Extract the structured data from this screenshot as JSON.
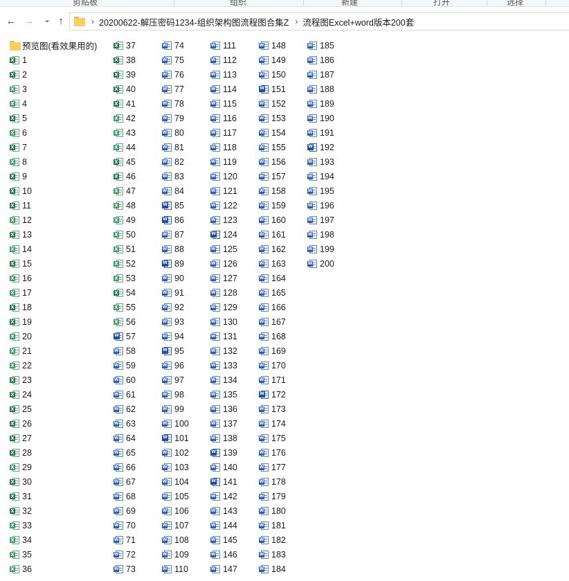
{
  "ribbon": {
    "groups": [
      "剪贴板",
      "组织",
      "新建",
      "打开",
      "选择"
    ]
  },
  "nav": {
    "back_icon": "←",
    "forward_icon": "→",
    "recent_icon": "⌄",
    "up_icon": "↑"
  },
  "breadcrumb": {
    "separator": "›",
    "items": [
      "20200622-解压密码1234-组织架构图流程图合集Z",
      "流程图Excel+word版本200套"
    ]
  },
  "files": {
    "folder": {
      "name": "预览图(看效果用的)",
      "icon": "folder-icon"
    },
    "columns": [
      [
        {
          "name": "1",
          "type": "xls"
        },
        {
          "name": "2",
          "type": "xls"
        },
        {
          "name": "3",
          "type": "xls-alt"
        },
        {
          "name": "4",
          "type": "xls-alt"
        },
        {
          "name": "5",
          "type": "xls"
        },
        {
          "name": "6",
          "type": "xls-alt"
        },
        {
          "name": "7",
          "type": "xls"
        },
        {
          "name": "8",
          "type": "xls-alt"
        },
        {
          "name": "9",
          "type": "xls"
        },
        {
          "name": "10",
          "type": "xls"
        },
        {
          "name": "11",
          "type": "xls"
        },
        {
          "name": "12",
          "type": "xls-alt"
        },
        {
          "name": "13",
          "type": "xls"
        },
        {
          "name": "14",
          "type": "xls-alt"
        },
        {
          "name": "15",
          "type": "xls"
        },
        {
          "name": "16",
          "type": "xls-alt"
        },
        {
          "name": "17",
          "type": "xls-alt"
        },
        {
          "name": "18",
          "type": "xls"
        },
        {
          "name": "19",
          "type": "xls"
        },
        {
          "name": "20",
          "type": "xls-alt"
        },
        {
          "name": "21",
          "type": "xls-alt"
        },
        {
          "name": "22",
          "type": "xls-alt"
        },
        {
          "name": "23",
          "type": "xls"
        },
        {
          "name": "24",
          "type": "xls"
        },
        {
          "name": "25",
          "type": "xls"
        },
        {
          "name": "26",
          "type": "xls"
        },
        {
          "name": "27",
          "type": "xls"
        },
        {
          "name": "28",
          "type": "xls"
        },
        {
          "name": "29",
          "type": "xls-alt"
        },
        {
          "name": "30",
          "type": "xls"
        },
        {
          "name": "31",
          "type": "xls"
        },
        {
          "name": "32",
          "type": "xls"
        },
        {
          "name": "33",
          "type": "xls-alt"
        },
        {
          "name": "34",
          "type": "xls-alt"
        },
        {
          "name": "35",
          "type": "xls-alt"
        },
        {
          "name": "36",
          "type": "xls-alt"
        }
      ],
      [
        {
          "name": "37",
          "type": "xls"
        },
        {
          "name": "38",
          "type": "xls"
        },
        {
          "name": "39",
          "type": "xls"
        },
        {
          "name": "40",
          "type": "xls"
        },
        {
          "name": "41",
          "type": "xls"
        },
        {
          "name": "42",
          "type": "xls-alt"
        },
        {
          "name": "43",
          "type": "xls-alt"
        },
        {
          "name": "44",
          "type": "xls-alt"
        },
        {
          "name": "45",
          "type": "xls"
        },
        {
          "name": "46",
          "type": "xls"
        },
        {
          "name": "47",
          "type": "xls-alt"
        },
        {
          "name": "48",
          "type": "xls-alt"
        },
        {
          "name": "49",
          "type": "xls-alt"
        },
        {
          "name": "50",
          "type": "xls-alt"
        },
        {
          "name": "51",
          "type": "xls-alt"
        },
        {
          "name": "52",
          "type": "xls-alt"
        },
        {
          "name": "53",
          "type": "xls-alt"
        },
        {
          "name": "54",
          "type": "xls"
        },
        {
          "name": "55",
          "type": "xls-alt"
        },
        {
          "name": "56",
          "type": "xls-alt"
        },
        {
          "name": "57",
          "type": "doc-new"
        },
        {
          "name": "58",
          "type": "doc"
        },
        {
          "name": "59",
          "type": "doc"
        },
        {
          "name": "60",
          "type": "doc"
        },
        {
          "name": "61",
          "type": "doc"
        },
        {
          "name": "62",
          "type": "doc"
        },
        {
          "name": "63",
          "type": "doc"
        },
        {
          "name": "64",
          "type": "doc"
        },
        {
          "name": "65",
          "type": "doc"
        },
        {
          "name": "66",
          "type": "doc"
        },
        {
          "name": "67",
          "type": "doc"
        },
        {
          "name": "68",
          "type": "doc"
        },
        {
          "name": "69",
          "type": "doc"
        },
        {
          "name": "70",
          "type": "doc"
        },
        {
          "name": "71",
          "type": "doc"
        },
        {
          "name": "72",
          "type": "doc"
        },
        {
          "name": "73",
          "type": "doc"
        }
      ],
      [
        {
          "name": "74",
          "type": "doc"
        },
        {
          "name": "75",
          "type": "doc"
        },
        {
          "name": "76",
          "type": "doc"
        },
        {
          "name": "77",
          "type": "doc"
        },
        {
          "name": "78",
          "type": "doc"
        },
        {
          "name": "79",
          "type": "doc"
        },
        {
          "name": "80",
          "type": "doc"
        },
        {
          "name": "81",
          "type": "doc"
        },
        {
          "name": "82",
          "type": "doc"
        },
        {
          "name": "83",
          "type": "doc"
        },
        {
          "name": "84",
          "type": "doc"
        },
        {
          "name": "85",
          "type": "doc-new"
        },
        {
          "name": "86",
          "type": "doc-new"
        },
        {
          "name": "87",
          "type": "doc"
        },
        {
          "name": "88",
          "type": "doc"
        },
        {
          "name": "89",
          "type": "doc-new"
        },
        {
          "name": "90",
          "type": "doc"
        },
        {
          "name": "91",
          "type": "doc"
        },
        {
          "name": "92",
          "type": "doc"
        },
        {
          "name": "93",
          "type": "doc"
        },
        {
          "name": "94",
          "type": "doc"
        },
        {
          "name": "95",
          "type": "doc-new"
        },
        {
          "name": "96",
          "type": "doc"
        },
        {
          "name": "97",
          "type": "doc"
        },
        {
          "name": "98",
          "type": "doc"
        },
        {
          "name": "99",
          "type": "doc"
        },
        {
          "name": "100",
          "type": "doc"
        },
        {
          "name": "101",
          "type": "doc-new"
        },
        {
          "name": "102",
          "type": "doc"
        },
        {
          "name": "103",
          "type": "doc"
        },
        {
          "name": "104",
          "type": "doc"
        },
        {
          "name": "105",
          "type": "doc"
        },
        {
          "name": "106",
          "type": "doc"
        },
        {
          "name": "107",
          "type": "doc"
        },
        {
          "name": "108",
          "type": "doc"
        },
        {
          "name": "109",
          "type": "doc"
        },
        {
          "name": "110",
          "type": "doc"
        }
      ],
      [
        {
          "name": "111",
          "type": "doc"
        },
        {
          "name": "112",
          "type": "doc"
        },
        {
          "name": "113",
          "type": "doc"
        },
        {
          "name": "114",
          "type": "doc"
        },
        {
          "name": "115",
          "type": "doc"
        },
        {
          "name": "116",
          "type": "doc"
        },
        {
          "name": "117",
          "type": "doc"
        },
        {
          "name": "118",
          "type": "doc"
        },
        {
          "name": "119",
          "type": "doc"
        },
        {
          "name": "120",
          "type": "doc"
        },
        {
          "name": "121",
          "type": "doc"
        },
        {
          "name": "122",
          "type": "doc"
        },
        {
          "name": "123",
          "type": "doc"
        },
        {
          "name": "124",
          "type": "doc-new"
        },
        {
          "name": "125",
          "type": "doc"
        },
        {
          "name": "126",
          "type": "doc"
        },
        {
          "name": "127",
          "type": "doc"
        },
        {
          "name": "128",
          "type": "doc"
        },
        {
          "name": "129",
          "type": "doc"
        },
        {
          "name": "130",
          "type": "doc"
        },
        {
          "name": "131",
          "type": "doc"
        },
        {
          "name": "132",
          "type": "doc"
        },
        {
          "name": "133",
          "type": "doc"
        },
        {
          "name": "134",
          "type": "doc"
        },
        {
          "name": "135",
          "type": "doc"
        },
        {
          "name": "136",
          "type": "doc"
        },
        {
          "name": "137",
          "type": "doc"
        },
        {
          "name": "138",
          "type": "doc"
        },
        {
          "name": "139",
          "type": "doc-new"
        },
        {
          "name": "140",
          "type": "doc"
        },
        {
          "name": "141",
          "type": "doc-new"
        },
        {
          "name": "142",
          "type": "doc"
        },
        {
          "name": "143",
          "type": "doc"
        },
        {
          "name": "144",
          "type": "doc"
        },
        {
          "name": "145",
          "type": "doc"
        },
        {
          "name": "146",
          "type": "doc"
        },
        {
          "name": "147",
          "type": "doc"
        }
      ],
      [
        {
          "name": "148",
          "type": "doc"
        },
        {
          "name": "149",
          "type": "doc"
        },
        {
          "name": "150",
          "type": "doc"
        },
        {
          "name": "151",
          "type": "doc-new"
        },
        {
          "name": "152",
          "type": "doc"
        },
        {
          "name": "153",
          "type": "doc"
        },
        {
          "name": "154",
          "type": "doc"
        },
        {
          "name": "155",
          "type": "doc"
        },
        {
          "name": "156",
          "type": "doc"
        },
        {
          "name": "157",
          "type": "doc"
        },
        {
          "name": "158",
          "type": "doc"
        },
        {
          "name": "159",
          "type": "doc"
        },
        {
          "name": "160",
          "type": "doc"
        },
        {
          "name": "161",
          "type": "doc"
        },
        {
          "name": "162",
          "type": "doc"
        },
        {
          "name": "163",
          "type": "doc"
        },
        {
          "name": "164",
          "type": "doc"
        },
        {
          "name": "165",
          "type": "doc"
        },
        {
          "name": "166",
          "type": "doc"
        },
        {
          "name": "167",
          "type": "doc"
        },
        {
          "name": "168",
          "type": "doc"
        },
        {
          "name": "169",
          "type": "doc"
        },
        {
          "name": "170",
          "type": "doc"
        },
        {
          "name": "171",
          "type": "doc"
        },
        {
          "name": "172",
          "type": "doc-new"
        },
        {
          "name": "173",
          "type": "doc"
        },
        {
          "name": "174",
          "type": "doc"
        },
        {
          "name": "175",
          "type": "doc"
        },
        {
          "name": "176",
          "type": "doc"
        },
        {
          "name": "177",
          "type": "doc"
        },
        {
          "name": "178",
          "type": "doc"
        },
        {
          "name": "179",
          "type": "doc"
        },
        {
          "name": "180",
          "type": "doc"
        },
        {
          "name": "181",
          "type": "doc"
        },
        {
          "name": "182",
          "type": "doc"
        },
        {
          "name": "183",
          "type": "doc"
        },
        {
          "name": "184",
          "type": "doc"
        }
      ],
      [
        {
          "name": "185",
          "type": "doc"
        },
        {
          "name": "186",
          "type": "doc"
        },
        {
          "name": "187",
          "type": "doc"
        },
        {
          "name": "188",
          "type": "doc"
        },
        {
          "name": "189",
          "type": "doc"
        },
        {
          "name": "190",
          "type": "doc"
        },
        {
          "name": "191",
          "type": "doc"
        },
        {
          "name": "192",
          "type": "doc-new"
        },
        {
          "name": "193",
          "type": "doc"
        },
        {
          "name": "194",
          "type": "doc"
        },
        {
          "name": "195",
          "type": "doc"
        },
        {
          "name": "196",
          "type": "doc"
        },
        {
          "name": "197",
          "type": "doc"
        },
        {
          "name": "198",
          "type": "doc"
        },
        {
          "name": "199",
          "type": "doc"
        },
        {
          "name": "200",
          "type": "doc"
        }
      ]
    ]
  },
  "colors": {
    "excel": "#1f7244",
    "excel_alt": "#3c9b63",
    "word": "#2b5fb4",
    "folder": "#f8cf5f"
  }
}
